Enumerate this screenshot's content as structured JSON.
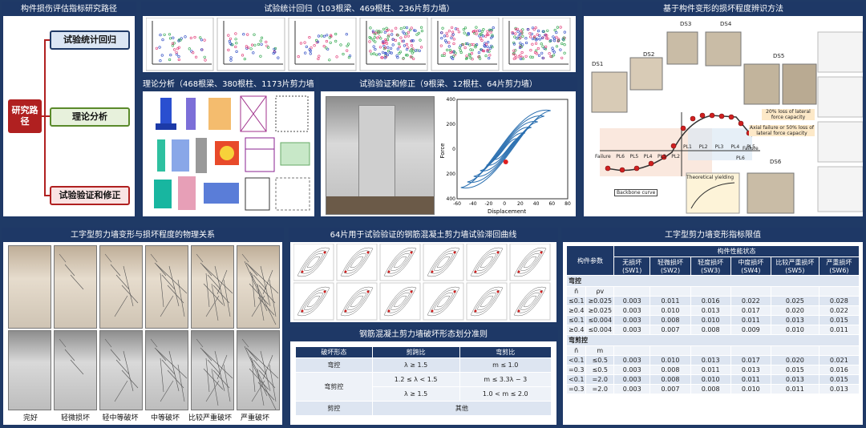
{
  "panels": {
    "route_title": "构件损伤评估指标研究路径",
    "route_key": "研究路径",
    "route_items": [
      "试验统计回归",
      "理论分析",
      "试验验证和修正"
    ],
    "stat_title": "试验统计回归（103根梁、469根柱、236片剪力墙）",
    "theory_title": "理论分析（468根梁、380根柱、1173片剪力墙）",
    "verify_title": "试验验证和修正（9根梁、12根柱、64片剪力墙）",
    "method_title": "基于构件变形的损坏程度辨识方法",
    "wall_title": "工字型剪力墙变形与损坏程度的物理关系",
    "curves_title": "64片用于试验验证的钢筋混凝土剪力墙试验滞回曲线",
    "criteria_title": "钢筋混凝土剪力墙破坏形态划分准则",
    "limits_title": "工字型剪力墙变形指标限值"
  },
  "verify_chart": {
    "xlabel": "Displacement",
    "ylabel": "Force",
    "xticks": [
      "-60",
      "-40",
      "-20",
      "0",
      "20",
      "40",
      "60",
      "80"
    ],
    "yticks": [
      "400",
      "200",
      "0",
      "200",
      "400"
    ]
  },
  "method": {
    "ds_labels": [
      "DS1",
      "DS2",
      "DS3",
      "DS4",
      "DS5",
      "DS6"
    ],
    "notes": [
      "20% loss of lateral force capacity",
      "Axial failure or 50% loss of lateral force capacity",
      "Theoretical yielding",
      "Backbone curve"
    ],
    "pl_top": [
      "PL1",
      "PL2",
      "PL3",
      "PL4",
      "PL5"
    ],
    "pl_bottom": [
      "Failure",
      "PL6",
      "PL5",
      "PL4",
      "PL3",
      "PL2"
    ],
    "pl_right": "PL6",
    "failure_right": "Failure"
  },
  "wall_states": [
    "完好",
    "轻微损坏",
    "轻中等破坏",
    "中等破坏",
    "比较严重破坏",
    "严重破坏"
  ],
  "criteria": {
    "headers": [
      "破坏形态",
      "剪跨比",
      "弯剪比"
    ],
    "rows": [
      {
        "mode": "弯控",
        "ratio": "λ ≥ 1.5",
        "mv": "m ≤ 1.0"
      },
      {
        "mode": "弯剪控",
        "ratio": "1.2 ≤ λ < 1.5",
        "mv": "m ≤ 3.3λ − 3"
      },
      {
        "mode": "",
        "ratio": "λ ≥ 1.5",
        "mv": "1.0 < m ≤ 2.0"
      },
      {
        "mode": "剪控",
        "ratio": "其他",
        "mv": ""
      }
    ]
  },
  "limits": {
    "param_header": "构件参数",
    "state_header": "构件性能状态",
    "states": [
      "无损坏 (SW1)",
      "轻微损坏 (SW2)",
      "轻度损坏 (SW3)",
      "中度损坏 (SW4)",
      "比较严重损坏 (SW5)",
      "严重损坏 (SW6)"
    ],
    "group1": "弯控",
    "g1_cols": [
      "n̄",
      "ρv"
    ],
    "g1_rows": [
      [
        "≤0.1",
        "≥0.025",
        "0.003",
        "0.011",
        "0.016",
        "0.022",
        "0.025",
        "0.028"
      ],
      [
        "≥0.4",
        "≥0.025",
        "0.003",
        "0.010",
        "0.013",
        "0.017",
        "0.020",
        "0.022"
      ],
      [
        "≤0.1",
        "≤0.004",
        "0.003",
        "0.008",
        "0.010",
        "0.011",
        "0.013",
        "0.015"
      ],
      [
        "≥0.4",
        "≤0.004",
        "0.003",
        "0.007",
        "0.008",
        "0.009",
        "0.010",
        "0.011"
      ]
    ],
    "group2": "弯剪控",
    "g2_cols": [
      "n̄",
      "m"
    ],
    "g2_rows": [
      [
        "<0.1",
        "≤0.5",
        "0.003",
        "0.010",
        "0.013",
        "0.017",
        "0.020",
        "0.021"
      ],
      [
        "=0.3",
        "≤0.5",
        "0.003",
        "0.008",
        "0.011",
        "0.013",
        "0.015",
        "0.016"
      ],
      [
        "<0.1",
        "=2.0",
        "0.003",
        "0.008",
        "0.010",
        "0.011",
        "0.013",
        "0.015"
      ],
      [
        "=0.3",
        "=2.0",
        "0.003",
        "0.007",
        "0.008",
        "0.010",
        "0.011",
        "0.013"
      ]
    ]
  }
}
